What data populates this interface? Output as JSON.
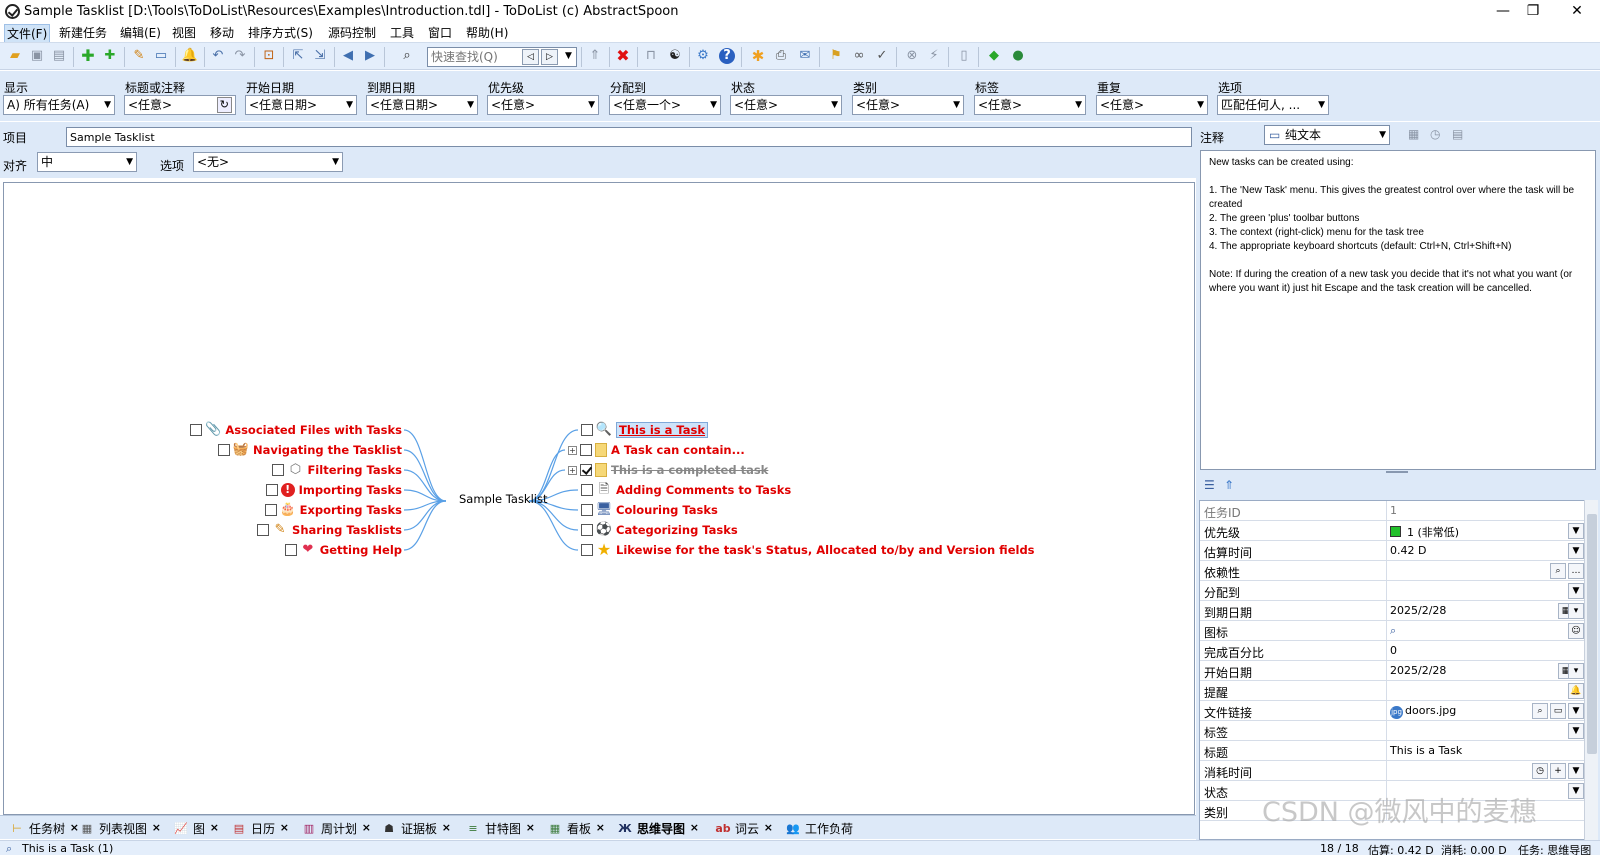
{
  "window": {
    "title": "Sample Tasklist [D:\\Tools\\ToDoList\\Resources\\Examples\\Introduction.tdl] - ToDoList (c) AbstractSpoon",
    "controls": {
      "minimize": "—",
      "restore": "❐",
      "close": "✕"
    }
  },
  "menu": [
    "文件(F)",
    "新建任务",
    "编辑(E)",
    "视图",
    "移动",
    "排序方式(S)",
    "源码控制",
    "工具",
    "窗口",
    "帮助(H)"
  ],
  "toolbar": {
    "quickfind_placeholder": "快速查找(Q)"
  },
  "filters": [
    {
      "label": "显示",
      "value": "A)  所有任务(A)"
    },
    {
      "label": "标题或注释",
      "value": "<任意>"
    },
    {
      "label": "开始日期",
      "value": "<任意日期>"
    },
    {
      "label": "到期日期",
      "value": "<任意日期>"
    },
    {
      "label": "优先级",
      "value": "<任意>"
    },
    {
      "label": "分配到",
      "value": "<任意一个>"
    },
    {
      "label": "状态",
      "value": "<任意>"
    },
    {
      "label": "类别",
      "value": "<任意>"
    },
    {
      "label": "标签",
      "value": "<任意>"
    },
    {
      "label": "重复",
      "value": "<任意>"
    },
    {
      "label": "选项",
      "value": "匹配任何人, ..."
    }
  ],
  "project": {
    "label": "项目",
    "name": "Sample Tasklist"
  },
  "view_options": {
    "align_label": "对齐",
    "align_value": "中",
    "options_label": "选项",
    "options_value": "<无>"
  },
  "mindmap": {
    "root": "Sample Tasklist",
    "left": [
      {
        "title": "Associated Files with Tasks",
        "icon": "paperclip-icon",
        "glyph": "📎"
      },
      {
        "title": "Navigating the Tasklist",
        "icon": "basket-icon",
        "glyph": "🧺"
      },
      {
        "title": "Filtering Tasks",
        "icon": "cube-icon",
        "glyph": "⬡"
      },
      {
        "title": "Importing Tasks",
        "icon": "warning-icon",
        "glyph": "!"
      },
      {
        "title": "Exporting Tasks",
        "icon": "cake-icon",
        "glyph": "🎂"
      },
      {
        "title": "Sharing Tasklists",
        "icon": "pencil-icon",
        "glyph": "✎"
      },
      {
        "title": "Getting Help",
        "icon": "heart-icon",
        "glyph": "❤"
      }
    ],
    "right": [
      {
        "title": "This is a Task",
        "icon": "magnifier-icon",
        "glyph": "🔍",
        "selected": true
      },
      {
        "title": "A Task can contain...",
        "icon": "folder-icon",
        "glyph": "",
        "expandable": true
      },
      {
        "title": "This is a completed task",
        "icon": "folder-icon",
        "glyph": "",
        "expandable": true,
        "done": true
      },
      {
        "title": "Adding Comments to Tasks",
        "icon": "document-icon",
        "glyph": "🗎"
      },
      {
        "title": "Colouring Tasks",
        "icon": "monitor-icon",
        "glyph": "🖥"
      },
      {
        "title": "Categorizing Tasks",
        "icon": "football-icon",
        "glyph": "⚽"
      },
      {
        "title": "Likewise for the task's Status, Allocated to/by and Version fields",
        "icon": "star-icon",
        "glyph": "★"
      }
    ]
  },
  "tabs": [
    "任务树",
    "列表视图",
    "图",
    "日历",
    "周计划",
    "证据板",
    "甘特图",
    "看板",
    "思维导图",
    "词云",
    "工作负荷"
  ],
  "notes": {
    "label": "注释",
    "format": "纯文本",
    "text": "New tasks can be created using:\n\n1. The 'New Task' menu. This gives the greatest control over where the task will be created\n2. The green 'plus' toolbar buttons\n3. The context (right-click) menu for the task tree\n4. The appropriate keyboard shortcuts (default: Ctrl+N, Ctrl+Shift+N)\n\nNote: If during the creation of a new task you decide that it's not what you want (or where you want it) just hit Escape and the task creation will be cancelled."
  },
  "properties": [
    {
      "name": "任务ID",
      "value": "1"
    },
    {
      "name": "优先级",
      "value": "1 (非常低)"
    },
    {
      "name": "估算时间",
      "value": "0.42 D"
    },
    {
      "name": "依赖性",
      "value": ""
    },
    {
      "name": "分配到",
      "value": ""
    },
    {
      "name": "到期日期",
      "value": "2025/2/28"
    },
    {
      "name": "图标",
      "value": ""
    },
    {
      "name": "完成百分比",
      "value": "0"
    },
    {
      "name": "开始日期",
      "value": "2025/2/28"
    },
    {
      "name": "提醒",
      "value": ""
    },
    {
      "name": "文件链接",
      "value": "doors.jpg"
    },
    {
      "name": "标签",
      "value": ""
    },
    {
      "name": "标题",
      "value": "This is a Task"
    },
    {
      "name": "消耗时间",
      "value": ""
    },
    {
      "name": "状态",
      "value": ""
    },
    {
      "name": "类别",
      "value": ""
    }
  ],
  "status": {
    "left": "This is a Task   (1)",
    "count": "18 / 18",
    "estimate": "估算: 0.42 D",
    "spent": "消耗: 0.00 D",
    "view": "任务: 思维导图"
  },
  "watermark": "CSDN @微风中的麦穗",
  "colors": {
    "accent": "#dde9f8",
    "task_text": "#e00000",
    "link": "#5aa0e6",
    "priority_low": "#22c02a"
  }
}
